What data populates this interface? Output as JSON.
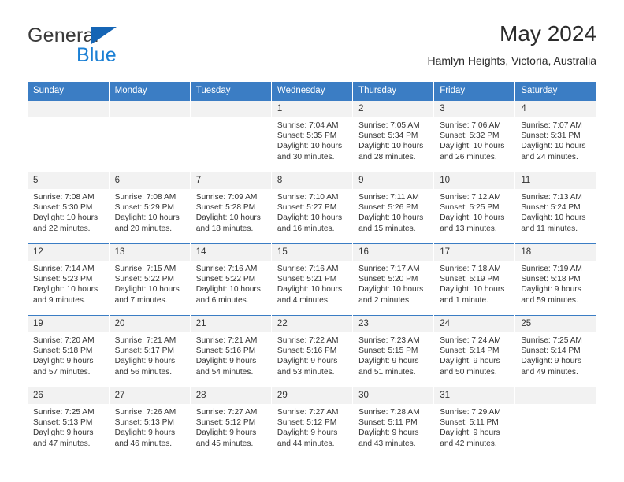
{
  "brand": {
    "name_top": "General",
    "name_bottom": "Blue",
    "triangle_color": "#1565b5",
    "blue_color": "#1a7fd4"
  },
  "header": {
    "title": "May 2024",
    "subtitle": "Hamlyn Heights, Victoria, Australia"
  },
  "theme": {
    "header_bg": "#3b7dc4",
    "daynum_bg": "#f2f2f2",
    "row_rule": "#3b7dc4",
    "text": "#333333"
  },
  "weekdays": [
    "Sunday",
    "Monday",
    "Tuesday",
    "Wednesday",
    "Thursday",
    "Friday",
    "Saturday"
  ],
  "weeks": [
    [
      {
        "day": "",
        "lines": []
      },
      {
        "day": "",
        "lines": []
      },
      {
        "day": "",
        "lines": []
      },
      {
        "day": "1",
        "lines": [
          "Sunrise: 7:04 AM",
          "Sunset: 5:35 PM",
          "Daylight: 10 hours",
          "and 30 minutes."
        ]
      },
      {
        "day": "2",
        "lines": [
          "Sunrise: 7:05 AM",
          "Sunset: 5:34 PM",
          "Daylight: 10 hours",
          "and 28 minutes."
        ]
      },
      {
        "day": "3",
        "lines": [
          "Sunrise: 7:06 AM",
          "Sunset: 5:32 PM",
          "Daylight: 10 hours",
          "and 26 minutes."
        ]
      },
      {
        "day": "4",
        "lines": [
          "Sunrise: 7:07 AM",
          "Sunset: 5:31 PM",
          "Daylight: 10 hours",
          "and 24 minutes."
        ]
      }
    ],
    [
      {
        "day": "5",
        "lines": [
          "Sunrise: 7:08 AM",
          "Sunset: 5:30 PM",
          "Daylight: 10 hours",
          "and 22 minutes."
        ]
      },
      {
        "day": "6",
        "lines": [
          "Sunrise: 7:08 AM",
          "Sunset: 5:29 PM",
          "Daylight: 10 hours",
          "and 20 minutes."
        ]
      },
      {
        "day": "7",
        "lines": [
          "Sunrise: 7:09 AM",
          "Sunset: 5:28 PM",
          "Daylight: 10 hours",
          "and 18 minutes."
        ]
      },
      {
        "day": "8",
        "lines": [
          "Sunrise: 7:10 AM",
          "Sunset: 5:27 PM",
          "Daylight: 10 hours",
          "and 16 minutes."
        ]
      },
      {
        "day": "9",
        "lines": [
          "Sunrise: 7:11 AM",
          "Sunset: 5:26 PM",
          "Daylight: 10 hours",
          "and 15 minutes."
        ]
      },
      {
        "day": "10",
        "lines": [
          "Sunrise: 7:12 AM",
          "Sunset: 5:25 PM",
          "Daylight: 10 hours",
          "and 13 minutes."
        ]
      },
      {
        "day": "11",
        "lines": [
          "Sunrise: 7:13 AM",
          "Sunset: 5:24 PM",
          "Daylight: 10 hours",
          "and 11 minutes."
        ]
      }
    ],
    [
      {
        "day": "12",
        "lines": [
          "Sunrise: 7:14 AM",
          "Sunset: 5:23 PM",
          "Daylight: 10 hours",
          "and 9 minutes."
        ]
      },
      {
        "day": "13",
        "lines": [
          "Sunrise: 7:15 AM",
          "Sunset: 5:22 PM",
          "Daylight: 10 hours",
          "and 7 minutes."
        ]
      },
      {
        "day": "14",
        "lines": [
          "Sunrise: 7:16 AM",
          "Sunset: 5:22 PM",
          "Daylight: 10 hours",
          "and 6 minutes."
        ]
      },
      {
        "day": "15",
        "lines": [
          "Sunrise: 7:16 AM",
          "Sunset: 5:21 PM",
          "Daylight: 10 hours",
          "and 4 minutes."
        ]
      },
      {
        "day": "16",
        "lines": [
          "Sunrise: 7:17 AM",
          "Sunset: 5:20 PM",
          "Daylight: 10 hours",
          "and 2 minutes."
        ]
      },
      {
        "day": "17",
        "lines": [
          "Sunrise: 7:18 AM",
          "Sunset: 5:19 PM",
          "Daylight: 10 hours",
          "and 1 minute."
        ]
      },
      {
        "day": "18",
        "lines": [
          "Sunrise: 7:19 AM",
          "Sunset: 5:18 PM",
          "Daylight: 9 hours",
          "and 59 minutes."
        ]
      }
    ],
    [
      {
        "day": "19",
        "lines": [
          "Sunrise: 7:20 AM",
          "Sunset: 5:18 PM",
          "Daylight: 9 hours",
          "and 57 minutes."
        ]
      },
      {
        "day": "20",
        "lines": [
          "Sunrise: 7:21 AM",
          "Sunset: 5:17 PM",
          "Daylight: 9 hours",
          "and 56 minutes."
        ]
      },
      {
        "day": "21",
        "lines": [
          "Sunrise: 7:21 AM",
          "Sunset: 5:16 PM",
          "Daylight: 9 hours",
          "and 54 minutes."
        ]
      },
      {
        "day": "22",
        "lines": [
          "Sunrise: 7:22 AM",
          "Sunset: 5:16 PM",
          "Daylight: 9 hours",
          "and 53 minutes."
        ]
      },
      {
        "day": "23",
        "lines": [
          "Sunrise: 7:23 AM",
          "Sunset: 5:15 PM",
          "Daylight: 9 hours",
          "and 51 minutes."
        ]
      },
      {
        "day": "24",
        "lines": [
          "Sunrise: 7:24 AM",
          "Sunset: 5:14 PM",
          "Daylight: 9 hours",
          "and 50 minutes."
        ]
      },
      {
        "day": "25",
        "lines": [
          "Sunrise: 7:25 AM",
          "Sunset: 5:14 PM",
          "Daylight: 9 hours",
          "and 49 minutes."
        ]
      }
    ],
    [
      {
        "day": "26",
        "lines": [
          "Sunrise: 7:25 AM",
          "Sunset: 5:13 PM",
          "Daylight: 9 hours",
          "and 47 minutes."
        ]
      },
      {
        "day": "27",
        "lines": [
          "Sunrise: 7:26 AM",
          "Sunset: 5:13 PM",
          "Daylight: 9 hours",
          "and 46 minutes."
        ]
      },
      {
        "day": "28",
        "lines": [
          "Sunrise: 7:27 AM",
          "Sunset: 5:12 PM",
          "Daylight: 9 hours",
          "and 45 minutes."
        ]
      },
      {
        "day": "29",
        "lines": [
          "Sunrise: 7:27 AM",
          "Sunset: 5:12 PM",
          "Daylight: 9 hours",
          "and 44 minutes."
        ]
      },
      {
        "day": "30",
        "lines": [
          "Sunrise: 7:28 AM",
          "Sunset: 5:11 PM",
          "Daylight: 9 hours",
          "and 43 minutes."
        ]
      },
      {
        "day": "31",
        "lines": [
          "Sunrise: 7:29 AM",
          "Sunset: 5:11 PM",
          "Daylight: 9 hours",
          "and 42 minutes."
        ]
      },
      {
        "day": "",
        "lines": []
      }
    ]
  ]
}
